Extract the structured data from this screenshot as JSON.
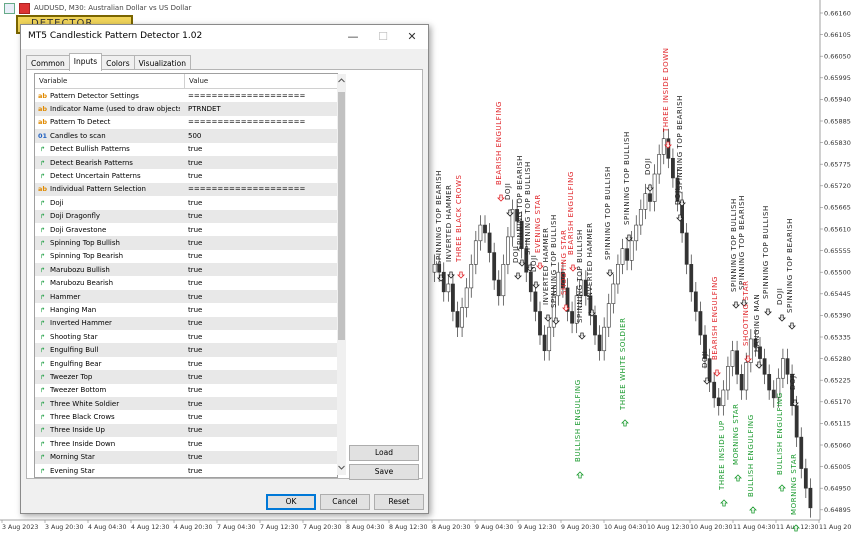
{
  "chart": {
    "title": "AUDUSD, M30:  Australian Dollar vs US Dollar",
    "detector_button": "DETECTOR",
    "price_labels": [
      "0.66160",
      "0.66105",
      "0.66050",
      "0.65995",
      "0.65940",
      "0.65885",
      "0.65830",
      "0.65775",
      "0.65720",
      "0.65665",
      "0.65610",
      "0.65555",
      "0.65500",
      "0.65445",
      "0.65390",
      "0.65335",
      "0.65280",
      "0.65225",
      "0.65170",
      "0.65115",
      "0.65060",
      "0.65005",
      "0.64950",
      "0.64895"
    ],
    "time_labels": [
      "3 Aug 2023",
      "3 Aug 20:30",
      "4 Aug 04:30",
      "4 Aug 12:30",
      "4 Aug 20:30",
      "7 Aug 04:30",
      "7 Aug 12:30",
      "7 Aug 20:30",
      "8 Aug 04:30",
      "8 Aug 12:30",
      "8 Aug 20:30",
      "9 Aug 04:30",
      "9 Aug 12:30",
      "9 Aug 20:30",
      "10 Aug 04:30",
      "10 Aug 12:30",
      "10 Aug 20:30",
      "11 Aug 04:30",
      "11 Aug 12:30",
      "11 Aug 20"
    ],
    "colors": {
      "bullish": "#1a9a2e",
      "bearish": "#e0252a",
      "neutral": "#222222"
    },
    "patterns": [
      {
        "text": "SPINNING TOP BEARISH",
        "kind": "neutral"
      },
      {
        "text": "INVERTED HAMMER",
        "kind": "neutral"
      },
      {
        "text": "THREE BLACK CROWS",
        "kind": "bearish"
      },
      {
        "text": "BEARISH ENGULFING",
        "kind": "bearish"
      },
      {
        "text": "DOJI",
        "kind": "neutral"
      },
      {
        "text": "SPINNING TOP BEARISH",
        "kind": "neutral"
      },
      {
        "text": "DOJI",
        "kind": "neutral"
      },
      {
        "text": "SPINNING TOP BULLISH",
        "kind": "neutral"
      },
      {
        "text": "EVENING STAR",
        "kind": "bearish"
      },
      {
        "text": "DOJI",
        "kind": "neutral"
      },
      {
        "text": "INVERTED HAMMER",
        "kind": "neutral"
      },
      {
        "text": "SPINNING TOP BULLISH",
        "kind": "neutral"
      },
      {
        "text": "SHOOTING STAR",
        "kind": "bearish"
      },
      {
        "text": "BEARISH ENGULFING",
        "kind": "bearish"
      },
      {
        "text": "SPINNING TOP BULLISH",
        "kind": "neutral"
      },
      {
        "text": "INVERTED HAMMER",
        "kind": "neutral"
      },
      {
        "text": "SPINNING TOP BULLISH",
        "kind": "neutral"
      },
      {
        "text": "SPINNING TOP BULLISH",
        "kind": "neutral"
      },
      {
        "text": "DOJI",
        "kind": "neutral"
      },
      {
        "text": "THREE INSIDE DOWN",
        "kind": "bearish"
      },
      {
        "text": "SPINNING TOP BEARISH",
        "kind": "neutral"
      },
      {
        "text": "DOJI",
        "kind": "neutral"
      },
      {
        "text": "BULLISH ENGULFING",
        "kind": "bullish"
      },
      {
        "text": "THREE WHITE SOLDIER",
        "kind": "bullish"
      },
      {
        "text": "DOJI",
        "kind": "neutral"
      },
      {
        "text": "BEARISH ENGULFING",
        "kind": "bearish"
      },
      {
        "text": "THREE INSIDE UP",
        "kind": "bullish"
      },
      {
        "text": "SPINNING TOP BULLISH",
        "kind": "neutral"
      },
      {
        "text": "MORNING STAR",
        "kind": "bullish"
      },
      {
        "text": "SPINNING TOP BEARISH",
        "kind": "neutral"
      },
      {
        "text": "BULLISH ENGULFING",
        "kind": "bullish"
      },
      {
        "text": "SHOOTING STAR",
        "kind": "bearish"
      },
      {
        "text": "HANGING MAN",
        "kind": "neutral"
      },
      {
        "text": "SPINNING TOP BULLISH",
        "kind": "neutral"
      },
      {
        "text": "BULLISH ENGULFING",
        "kind": "bullish"
      },
      {
        "text": "DOJI",
        "kind": "neutral"
      },
      {
        "text": "SPINNING TOP BEARISH",
        "kind": "neutral"
      },
      {
        "text": "DOJI",
        "kind": "neutral"
      },
      {
        "text": "MORNING STAR",
        "kind": "bullish"
      }
    ]
  },
  "dialog": {
    "title": "MT5 Candlestick Pattern Detector 1.02",
    "window_buttons": {
      "minimize": "—",
      "maximize": "☐",
      "close": "✕"
    },
    "tabs": [
      "Common",
      "Inputs",
      "Colors",
      "Visualization"
    ],
    "active_tab": "Inputs",
    "columns": {
      "variable": "Variable",
      "value": "Value"
    },
    "rows": [
      {
        "icon": "ab",
        "name": "Pattern Detector Settings",
        "value": "===================="
      },
      {
        "icon": "ab",
        "name": "Indicator Name (used to draw objects)",
        "value": "PTRNDET"
      },
      {
        "icon": "ab",
        "name": "Pattern To Detect",
        "value": "===================="
      },
      {
        "icon": "01",
        "name": "Candles to scan",
        "value": "500"
      },
      {
        "icon": "bool",
        "name": "Detect Bullish Patterns",
        "value": "true"
      },
      {
        "icon": "bool",
        "name": "Detect Bearish Patterns",
        "value": "true"
      },
      {
        "icon": "bool",
        "name": "Detect Uncertain Patterns",
        "value": "true"
      },
      {
        "icon": "ab",
        "name": "Individual Pattern Selection",
        "value": "===================="
      },
      {
        "icon": "bool",
        "name": "Doji",
        "value": "true"
      },
      {
        "icon": "bool",
        "name": "Doji Dragonfly",
        "value": "true"
      },
      {
        "icon": "bool",
        "name": "Doji Gravestone",
        "value": "true"
      },
      {
        "icon": "bool",
        "name": "Spinning Top Bullish",
        "value": "true"
      },
      {
        "icon": "bool",
        "name": "Spinning Top Bearish",
        "value": "true"
      },
      {
        "icon": "bool",
        "name": "Marubozu Bullish",
        "value": "true"
      },
      {
        "icon": "bool",
        "name": "Marubozu Bearish",
        "value": "true"
      },
      {
        "icon": "bool",
        "name": "Hammer",
        "value": "true"
      },
      {
        "icon": "bool",
        "name": "Hanging Man",
        "value": "true"
      },
      {
        "icon": "bool",
        "name": "Inverted Hammer",
        "value": "true"
      },
      {
        "icon": "bool",
        "name": "Shooting Star",
        "value": "true"
      },
      {
        "icon": "bool",
        "name": "Engulfing Bull",
        "value": "true"
      },
      {
        "icon": "bool",
        "name": "Engulfing Bear",
        "value": "true"
      },
      {
        "icon": "bool",
        "name": "Tweezer Top",
        "value": "true"
      },
      {
        "icon": "bool",
        "name": "Tweezer Bottom",
        "value": "true"
      },
      {
        "icon": "bool",
        "name": "Three White Soldier",
        "value": "true"
      },
      {
        "icon": "bool",
        "name": "Three Black Crows",
        "value": "true"
      },
      {
        "icon": "bool",
        "name": "Three Inside Up",
        "value": "true"
      },
      {
        "icon": "bool",
        "name": "Three Inside Down",
        "value": "true"
      },
      {
        "icon": "bool",
        "name": "Morning Star",
        "value": "true"
      },
      {
        "icon": "bool",
        "name": "Evening Star",
        "value": "true"
      }
    ],
    "side_buttons": {
      "load": "Load",
      "save": "Save"
    },
    "footer_buttons": {
      "ok": "OK",
      "cancel": "Cancel",
      "reset": "Reset"
    }
  }
}
